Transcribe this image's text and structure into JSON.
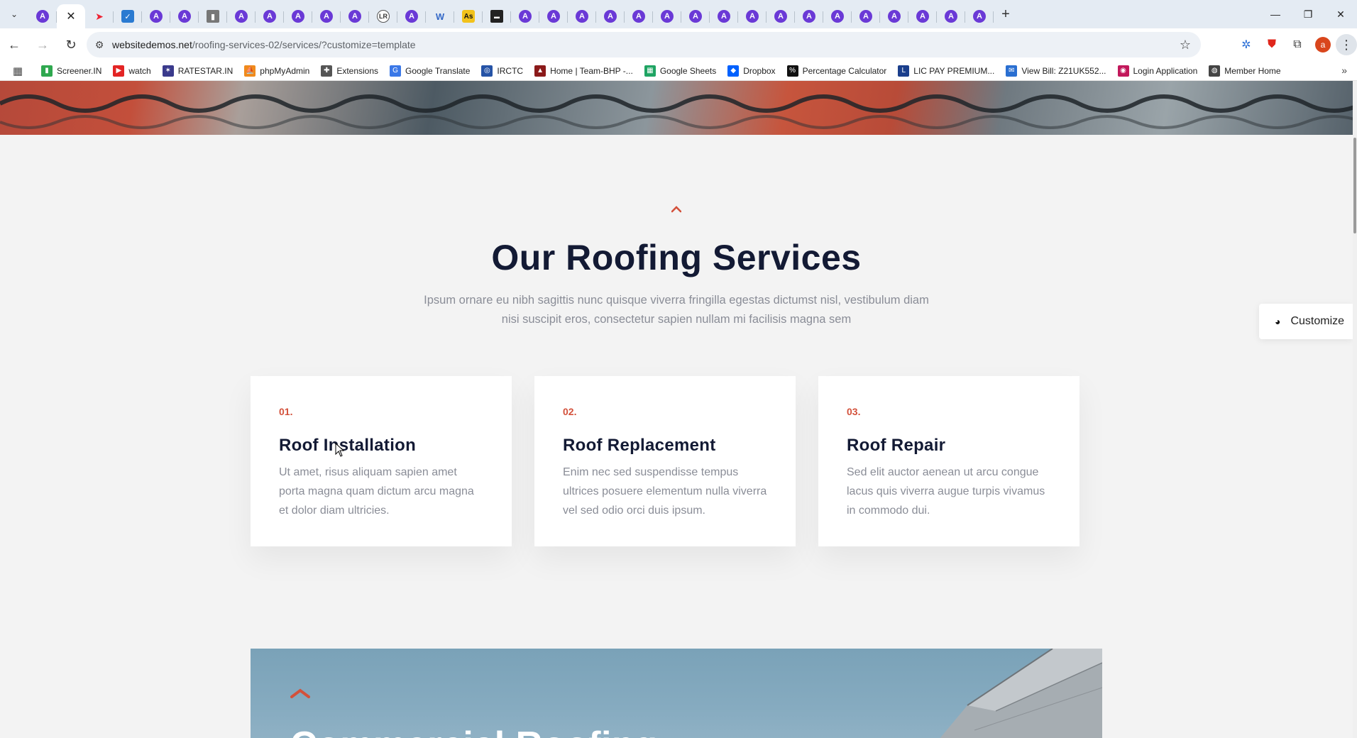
{
  "browser": {
    "tab_count_label": "⌄",
    "active_tab_close": "✕",
    "new_tab": "+",
    "window_controls": {
      "minimize": "—",
      "restore": "❐",
      "close": "✕"
    },
    "url_host": "websitedemos.net",
    "url_path": "/roofing-services-02/services/?customize=template",
    "bookmarks": [
      {
        "label": "Screener.IN",
        "icon": "bar-chart-icon",
        "color": "#2fa84f"
      },
      {
        "label": "watch",
        "icon": "youtube-icon",
        "color": "#e32424"
      },
      {
        "label": "RATESTAR.IN",
        "icon": "ratestar-icon",
        "color": "#3a3a8c"
      },
      {
        "label": "phpMyAdmin",
        "icon": "phpmyadmin-icon",
        "color": "#f08a1c"
      },
      {
        "label": "Extensions",
        "icon": "puzzle-icon",
        "color": "#555555"
      },
      {
        "label": "Google Translate",
        "icon": "translate-icon",
        "color": "#3b78e7"
      },
      {
        "label": "IRCTC",
        "icon": "irctc-icon",
        "color": "#2553a6"
      },
      {
        "label": "Home | Team-BHP -...",
        "icon": "teambhp-icon",
        "color": "#8b1a1a"
      },
      {
        "label": "Google Sheets",
        "icon": "sheets-icon",
        "color": "#1fa463"
      },
      {
        "label": "Dropbox",
        "icon": "dropbox-icon",
        "color": "#0061fe"
      },
      {
        "label": "Percentage Calculator",
        "icon": "percent-icon",
        "color": "#111111"
      },
      {
        "label": "LIC PAY PREMIUM...",
        "icon": "lic-icon",
        "color": "#1b3f8c"
      },
      {
        "label": "View Bill: Z21UK552...",
        "icon": "bill-icon",
        "color": "#2a6fd1"
      },
      {
        "label": "Login Application",
        "icon": "login-icon",
        "color": "#c2185b"
      },
      {
        "label": "Member Home",
        "icon": "globe-icon",
        "color": "#444444"
      }
    ]
  },
  "page": {
    "section_title": "Our Roofing Services",
    "section_subtitle": "Ipsum ornare eu nibh sagittis nunc quisque viverra fringilla egestas dictumst nisl, vestibulum diam nisi suscipit eros, consectetur sapien nullam mi facilisis magna sem",
    "services": [
      {
        "number": "01.",
        "title": "Roof Installation",
        "description": "Ut amet, risus aliquam sapien amet porta magna quam dictum arcu magna et dolor diam ultricies."
      },
      {
        "number": "02.",
        "title": "Roof Replacement",
        "description": "Enim nec sed suspendisse tempus ultrices posuere elementum nulla viverra vel sed odio orci duis ipsum."
      },
      {
        "number": "03.",
        "title": "Roof Repair",
        "description": "Sed elit auctor aenean ut arcu congue lacus quis viverra augue turpis vivamus in commodo dui."
      }
    ],
    "customize_label": "Customize",
    "next_section_title": "Commercial Roofing",
    "accent_color": "#d3513b",
    "heading_color": "#131a34"
  }
}
